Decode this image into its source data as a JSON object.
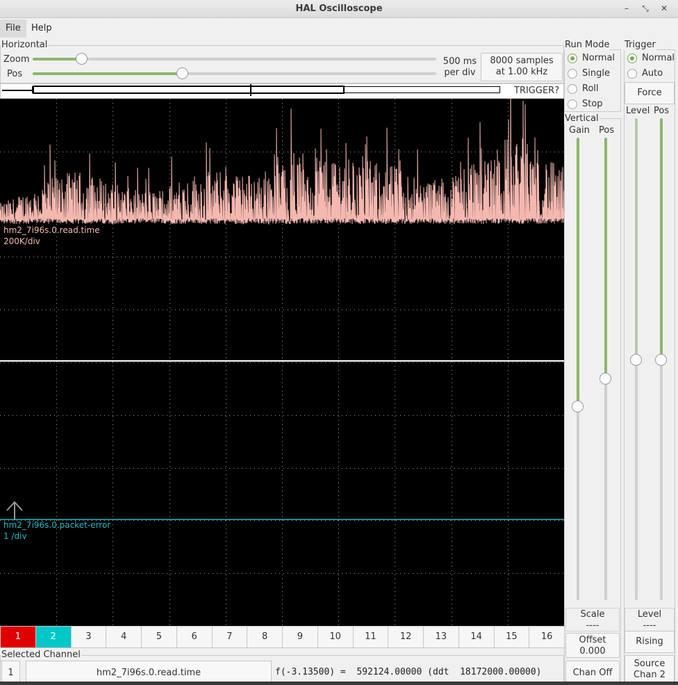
{
  "window": {
    "title": "HAL Oscilloscope"
  },
  "menu": {
    "file": "File",
    "help": "Help"
  },
  "horizontal": {
    "label": "Horizontal",
    "zoom_label": "Zoom",
    "pos_label": "Pos",
    "zoom_value": 0.12,
    "pos_value": 0.37,
    "time_per_div_1": "500 ms",
    "time_per_div_2": "per div",
    "samples_1": "8000 samples",
    "samples_2": "at 1.00 kHz",
    "trigger_status": "TRIGGER?"
  },
  "run_mode": {
    "label": "Run Mode",
    "options": [
      "Normal",
      "Single",
      "Roll",
      "Stop"
    ],
    "selected": 0
  },
  "trigger": {
    "label": "Trigger",
    "options": [
      "Normal",
      "Auto"
    ],
    "selected": 0,
    "force": "Force",
    "level_label": "Level",
    "pos_label": "Pos",
    "level_value": 0.5,
    "pos_value": 0.5,
    "level_title": "Level",
    "level_readout": "----",
    "rising": "Rising",
    "source_1": "Source",
    "source_2": "Chan  2"
  },
  "vertical": {
    "label": "Vertical",
    "gain_label": "Gain",
    "pos_label": "Pos",
    "gain_value": 0.42,
    "pos_value": 0.48,
    "scale_title": "Scale",
    "scale_readout": "----",
    "offset_title": "Offset",
    "offset_value": "0.000",
    "chan_off": "Chan Off"
  },
  "traces": {
    "ch1_name": "hm2_7i96s.0.read.time",
    "ch1_scale": "200K/div",
    "ch1_color": "#f4b8b0",
    "ch2_name": "hm2_7i96s.0.packet-error",
    "ch2_scale": "1 /div",
    "ch2_color": "#22b8c8"
  },
  "channels": {
    "labels": [
      "1",
      "2",
      "3",
      "4",
      "5",
      "6",
      "7",
      "8",
      "9",
      "10",
      "11",
      "12",
      "13",
      "14",
      "15",
      "16"
    ],
    "ch1_color": "#e00000",
    "ch2_color": "#00c8c8"
  },
  "selected": {
    "label": "Selected Channel",
    "number": "1",
    "name": "hm2_7i96s.0.read.time",
    "readout": "f(-3.13500) =  592124.00000 (ddt  18172000.00000)"
  }
}
